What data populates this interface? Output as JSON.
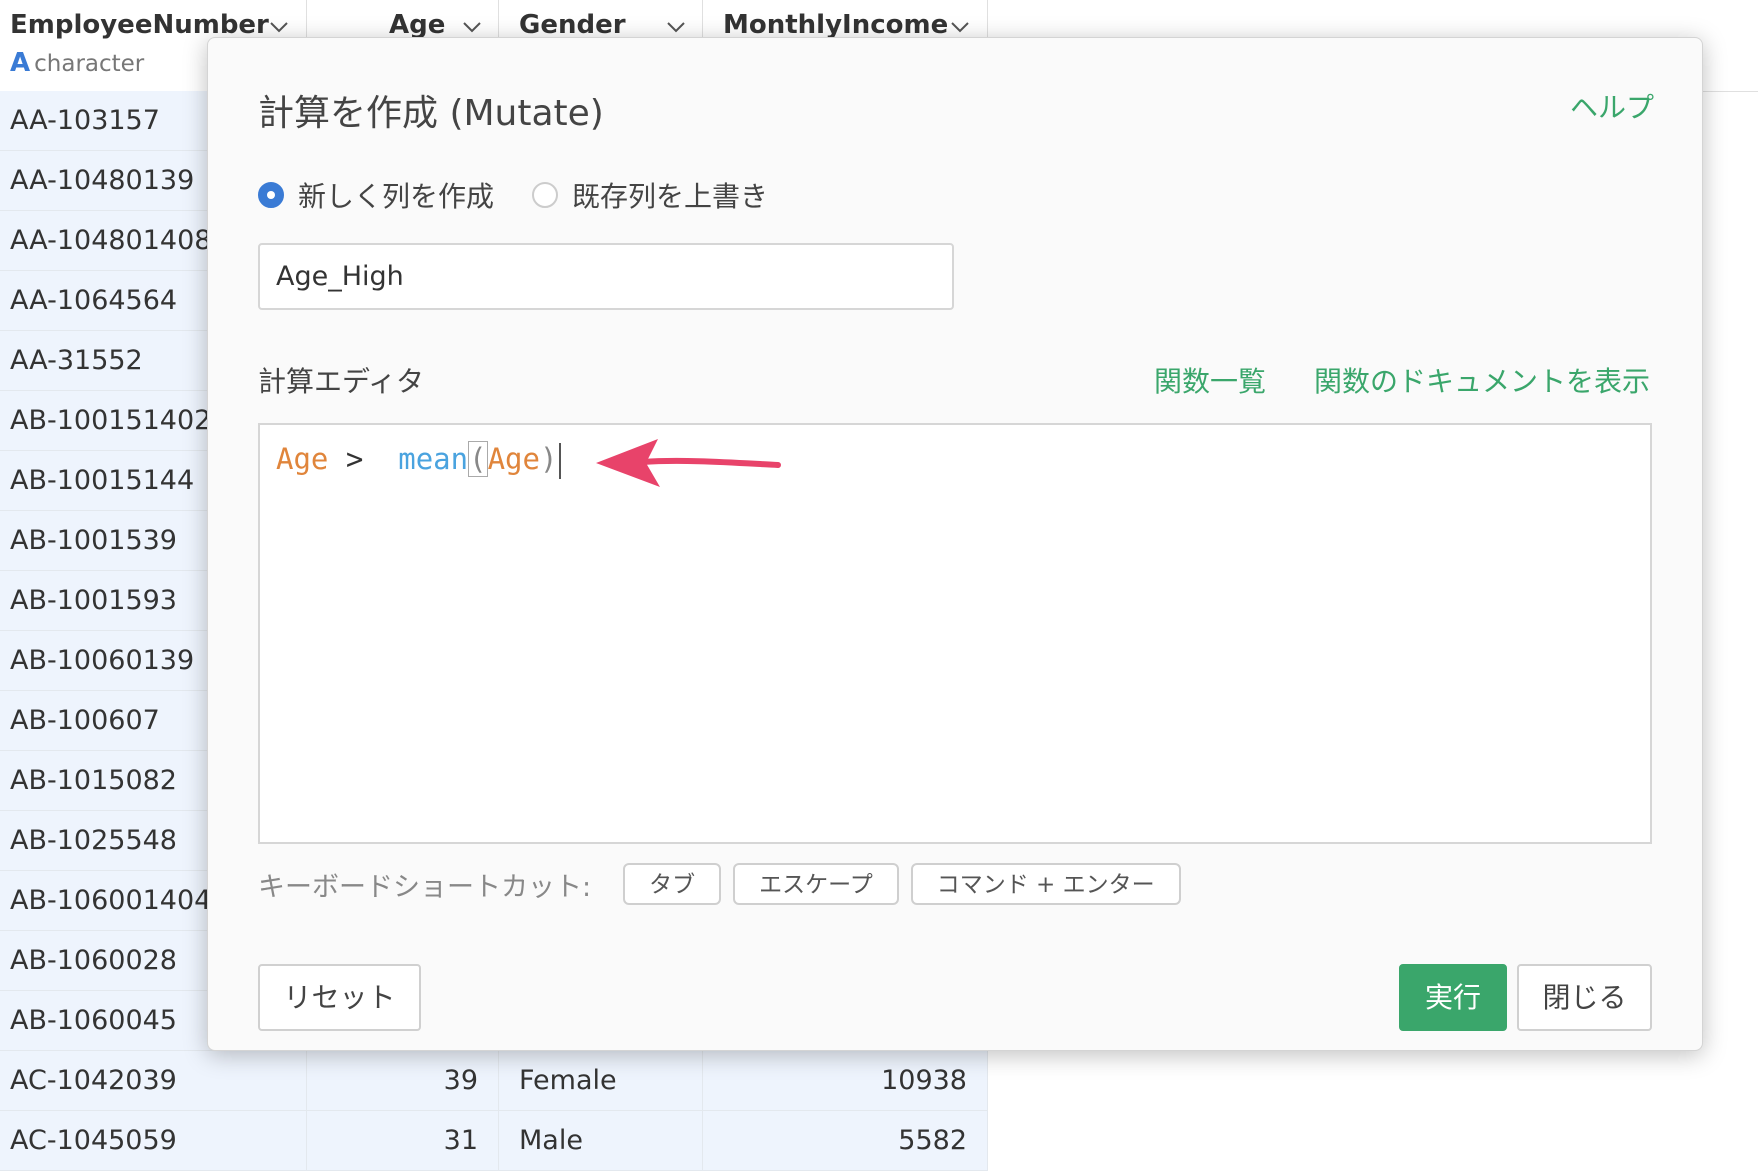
{
  "table": {
    "columns": [
      {
        "name": "EmployeeNumber",
        "type": "character",
        "type_icon": "A"
      },
      {
        "name": "Age"
      },
      {
        "name": "Gender"
      },
      {
        "name": "MonthlyIncome"
      }
    ],
    "rows": [
      {
        "emp": "AA-103157"
      },
      {
        "emp": "AA-10480139"
      },
      {
        "emp": "AA-104801408"
      },
      {
        "emp": "AA-1064564"
      },
      {
        "emp": "AA-31552"
      },
      {
        "emp": "AB-100151402"
      },
      {
        "emp": "AB-10015144"
      },
      {
        "emp": "AB-1001539"
      },
      {
        "emp": "AB-1001593"
      },
      {
        "emp": "AB-10060139"
      },
      {
        "emp": "AB-100607"
      },
      {
        "emp": "AB-1015082"
      },
      {
        "emp": "AB-1025548"
      },
      {
        "emp": "AB-106001404"
      },
      {
        "emp": "AB-1060028"
      },
      {
        "emp": "AB-1060045"
      },
      {
        "emp": "AC-1042039",
        "age": "39",
        "gender": "Female",
        "income": "10938"
      },
      {
        "emp": "AC-1045059",
        "age": "31",
        "gender": "Male",
        "income": "5582"
      }
    ]
  },
  "modal": {
    "title": "計算を作成 (Mutate)",
    "help": "ヘルプ",
    "radio_new": "新しく列を作成",
    "radio_overwrite": "既存列を上書き",
    "column_name_value": "Age_High",
    "editor_label": "計算エディタ",
    "func_list": "関数一覧",
    "func_doc": "関数のドキュメントを表示",
    "code": {
      "var1": "Age",
      "op": " > ",
      "fn": "mean",
      "open": "(",
      "arg": "Age",
      "close": ")"
    },
    "shortcut_label": "キーボードショートカット:",
    "shortcuts": [
      "タブ",
      "エスケープ",
      "コマンド + エンター"
    ],
    "reset": "リセット",
    "run": "実行",
    "close": "閉じる"
  },
  "colors": {
    "accent_green": "#3aa66b",
    "radio_blue": "#3a7bd5",
    "arrow_pink": "#e8436a"
  }
}
